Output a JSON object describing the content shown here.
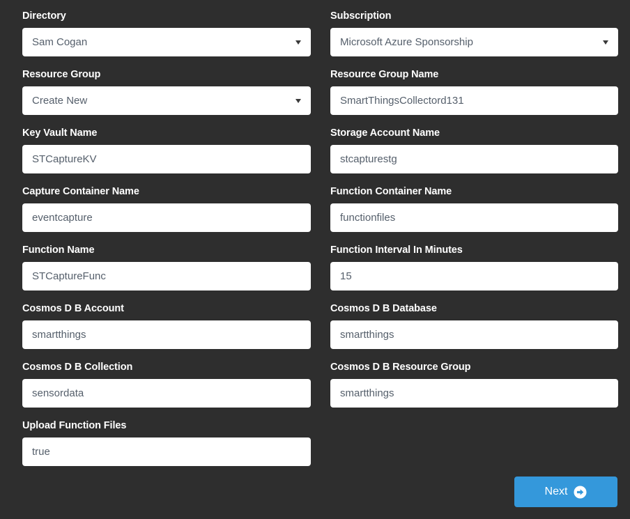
{
  "theme": {
    "background": "#2e2e2e",
    "field_background": "#ffffff",
    "label_color": "#ffffff",
    "value_color": "#555f6b",
    "accent": "#3498db"
  },
  "form": {
    "fields": [
      {
        "label": "Directory",
        "value": "Sam Cogan",
        "type": "select",
        "column": "left"
      },
      {
        "label": "Subscription",
        "value": "Microsoft Azure Sponsorship",
        "type": "select",
        "column": "right"
      },
      {
        "label": "Resource Group",
        "value": "Create New",
        "type": "select",
        "column": "left"
      },
      {
        "label": "Resource Group Name",
        "value": "SmartThingsCollectord131",
        "type": "text",
        "column": "right"
      },
      {
        "label": "Key Vault Name",
        "value": "STCaptureKV",
        "type": "text",
        "column": "left"
      },
      {
        "label": "Storage Account Name",
        "value": "stcapturestg",
        "type": "text",
        "column": "right"
      },
      {
        "label": "Capture Container Name",
        "value": "eventcapture",
        "type": "text",
        "column": "left"
      },
      {
        "label": "Function Container Name",
        "value": "functionfiles",
        "type": "text",
        "column": "right"
      },
      {
        "label": "Function Name",
        "value": "STCaptureFunc",
        "type": "text",
        "column": "left"
      },
      {
        "label": "Function Interval In Minutes",
        "value": "15",
        "type": "text",
        "column": "right"
      },
      {
        "label": "Cosmos D B Account",
        "value": "smartthings",
        "type": "text",
        "column": "left"
      },
      {
        "label": "Cosmos D B Database",
        "value": "smartthings",
        "type": "text",
        "column": "right"
      },
      {
        "label": "Cosmos D B Collection",
        "value": "sensordata",
        "type": "text",
        "column": "left"
      },
      {
        "label": "Cosmos D B Resource Group",
        "value": "smartthings",
        "type": "text",
        "column": "right"
      },
      {
        "label": "Upload Function Files",
        "value": "true",
        "type": "text",
        "column": "left"
      }
    ]
  },
  "footer": {
    "next_label": "Next",
    "next_icon": "arrow-circle-right-icon"
  }
}
